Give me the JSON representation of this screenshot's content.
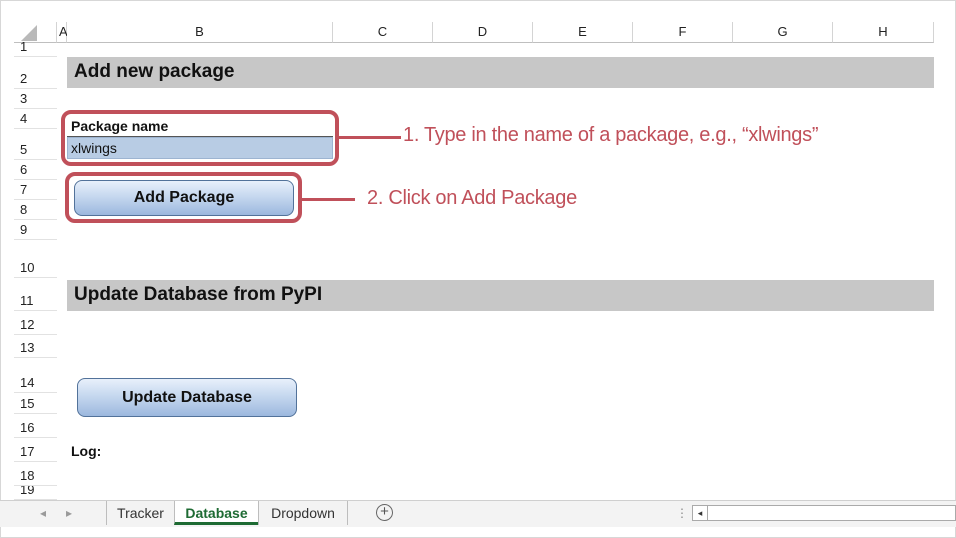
{
  "columns": [
    "A",
    "B",
    "C",
    "D",
    "E",
    "F",
    "G",
    "H"
  ],
  "rows": [
    "1",
    "2",
    "3",
    "4",
    "5",
    "6",
    "7",
    "8",
    "9",
    "10",
    "11",
    "12",
    "13",
    "14",
    "15",
    "16",
    "17",
    "18",
    "19"
  ],
  "sections": {
    "add_package_title": "Add new package",
    "update_db_title": "Update Database from PyPI"
  },
  "form": {
    "package_name_label": "Package name",
    "package_name_value": "xlwings",
    "log_label": "Log:"
  },
  "buttons": {
    "add_package": "Add Package",
    "update_database": "Update Database"
  },
  "callouts": {
    "step1": "1. Type in the name of a package, e.g., “xlwings”",
    "step2": "2. Click on Add Package"
  },
  "sheet_tabs": [
    "Tracker",
    "Database",
    "Dropdown"
  ],
  "active_sheet": "Database",
  "icons": {
    "prev_sheet": "◂",
    "next_sheet": "▸",
    "add_sheet": "+",
    "scroll_left": "◂"
  },
  "colors": {
    "callout": "#c0505a",
    "active_tab": "#1e6b33",
    "input_fill": "#b8cce4",
    "section_fill": "#c7c7c7"
  }
}
